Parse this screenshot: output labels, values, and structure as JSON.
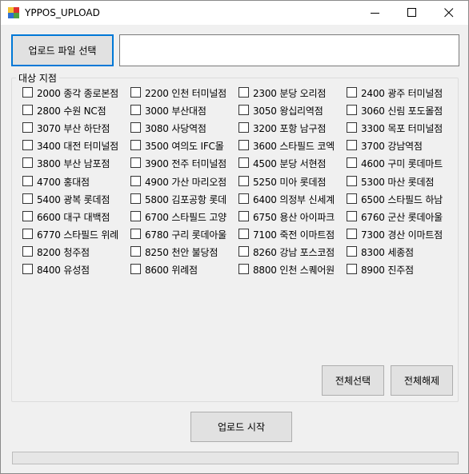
{
  "window": {
    "title": "YPPOS_UPLOAD"
  },
  "toolbar": {
    "select_file_label": "업로드 파일 선택",
    "file_path_value": ""
  },
  "stores_group": {
    "label": "대상 지점",
    "items": [
      {
        "label": "2000 종각 종로본점",
        "checked": false
      },
      {
        "label": "2200 인천 터미널점",
        "checked": false
      },
      {
        "label": "2300 분당 오리점",
        "checked": false
      },
      {
        "label": "2400 광주 터미널점",
        "checked": false
      },
      {
        "label": "2800 수원 NC점",
        "checked": false
      },
      {
        "label": "3000 부산대점",
        "checked": false
      },
      {
        "label": "3050 왕십리역점",
        "checked": false
      },
      {
        "label": "3060 신림 포도몰점",
        "checked": false
      },
      {
        "label": "3070 부산 하단점",
        "checked": false
      },
      {
        "label": "3080 사당역점",
        "checked": false
      },
      {
        "label": "3200 포항 남구점",
        "checked": false
      },
      {
        "label": "3300 목포 터미널점",
        "checked": false
      },
      {
        "label": "3400 대전 터미널점",
        "checked": false
      },
      {
        "label": "3500 여의도 IFC몰",
        "checked": false
      },
      {
        "label": "3600 스타필드 코엑",
        "checked": false
      },
      {
        "label": "3700 강남역점",
        "checked": false
      },
      {
        "label": "3800 부산 남포점",
        "checked": false
      },
      {
        "label": "3900 전주 터미널점",
        "checked": false
      },
      {
        "label": "4500 분당 서현점",
        "checked": false
      },
      {
        "label": "4600 구미 롯데마트",
        "checked": false
      },
      {
        "label": "4700 홍대점",
        "checked": false
      },
      {
        "label": "4900 가산 마리오점",
        "checked": false
      },
      {
        "label": "5250 미아 롯데점",
        "checked": false
      },
      {
        "label": "5300 마산 롯데점",
        "checked": false
      },
      {
        "label": "5400 광복 롯데점",
        "checked": false
      },
      {
        "label": "5800 김포공항 롯데",
        "checked": false
      },
      {
        "label": "6400 의정부 신세계",
        "checked": false
      },
      {
        "label": "6500 스타필드 하남",
        "checked": false
      },
      {
        "label": "6600 대구 대백점",
        "checked": false
      },
      {
        "label": "6700 스타필드 고양",
        "checked": false
      },
      {
        "label": "6750 용산 아이파크",
        "checked": false
      },
      {
        "label": "6760 군산 롯데아울",
        "checked": false
      },
      {
        "label": "6770 스타필드 위례",
        "checked": false
      },
      {
        "label": "6780 구리 롯데아울",
        "checked": false
      },
      {
        "label": "7100 죽전 이마트점",
        "checked": false
      },
      {
        "label": "7300 경산 이마트점",
        "checked": false
      },
      {
        "label": "8200 청주점",
        "checked": false
      },
      {
        "label": "8250 천안 불당점",
        "checked": false
      },
      {
        "label": "8260 강남 포스코점",
        "checked": false
      },
      {
        "label": "8300 세종점",
        "checked": false
      },
      {
        "label": "8400 유성점",
        "checked": false
      },
      {
        "label": "8600 위례점",
        "checked": false
      },
      {
        "label": "8800 인천 스퀘어원",
        "checked": false
      },
      {
        "label": "8900 진주점",
        "checked": false
      }
    ],
    "select_all_label": "전체선택",
    "deselect_all_label": "전체해제"
  },
  "upload": {
    "start_label": "업로드 시작",
    "progress": 0
  },
  "colors": {
    "focus_border": "#0078d7",
    "button_face": "#e1e1e1",
    "window_bg": "#f0f0f0"
  }
}
